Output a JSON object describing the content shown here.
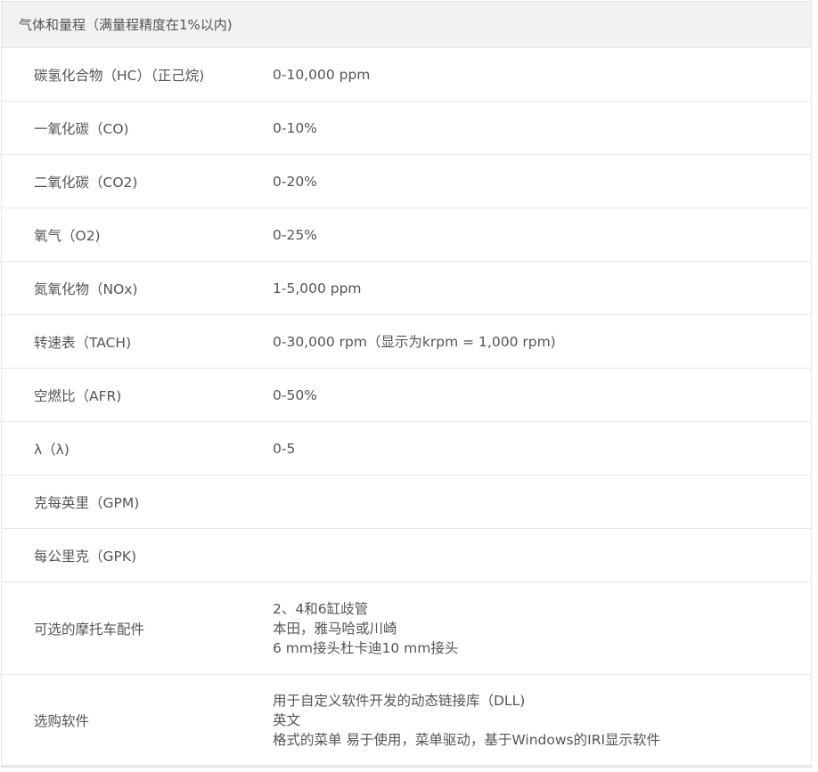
{
  "header": {
    "title": "气体和量程（满量程精度在1%以内)"
  },
  "rows": [
    {
      "name": "碳氢化合物（HC）（正己烷)",
      "value": "0-10,000 ppm"
    },
    {
      "name": "一氧化碳（CO)",
      "value": "0-10%"
    },
    {
      "name": "二氧化碳（CO2)",
      "value": "0-20%"
    },
    {
      "name": "氧气（O2)",
      "value": "0-25%"
    },
    {
      "name": "氮氧化物（NOx)",
      "value": "1-5,000 ppm"
    },
    {
      "name": "转速表（TACH)",
      "value": "0-30,000 rpm（显示为krpm = 1,000 rpm)"
    },
    {
      "name": "空燃比（AFR)",
      "value": "0-50%"
    },
    {
      "name": "λ（λ)",
      "value": "0-5"
    },
    {
      "name": "克每英里（GPM)",
      "value": ""
    },
    {
      "name": "每公里克（GPK)",
      "value": ""
    }
  ],
  "moto": {
    "name": "可选的摩托车配件",
    "lines": [
      "2、4和6缸歧管",
      "本田，雅马哈或川崎",
      "6 mm接头杜卡迪10 mm接头"
    ]
  },
  "software": {
    "name": "选购软件",
    "lines": [
      "用于自定义软件开发的动态链接库（DLL)",
      "英文",
      "格式的菜单 易于使用，菜单驱动，基于Windows的IRI显示软件"
    ]
  }
}
